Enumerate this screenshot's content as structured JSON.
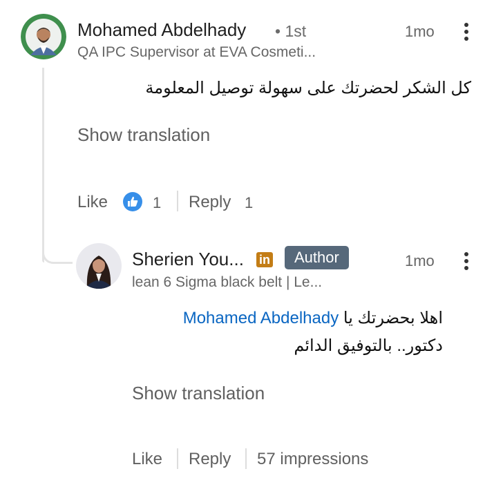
{
  "comment": {
    "author_name": "Mohamed Abdelhady",
    "degree": "• 1st",
    "headline": "QA IPC Supervisor at EVA Cosmeti...",
    "time": "1mo",
    "body": "كل الشكر لحضرتك على سهولة توصيل المعلومة",
    "show_translation": "Show translation",
    "like_label": "Like",
    "like_count": "1",
    "reply_label": "Reply",
    "reply_count": "1",
    "avatar_icon": "profile-photo",
    "more_icon": "kebab-menu"
  },
  "reply": {
    "author_name": "Sherien You...",
    "linkedin_badge": "in",
    "author_badge": "Author",
    "headline": "lean 6 Sigma black belt | Le...",
    "time": "1mo",
    "body_prefix": "اهلا بحضرتك يا",
    "mention": "Mohamed Abdelhady",
    "body_suffix": "دكتور.. بالتوفيق الدائم",
    "show_translation": "Show translation",
    "like_label": "Like",
    "reply_label": "Reply",
    "impressions": "57 impressions",
    "avatar_icon": "profile-photo",
    "more_icon": "kebab-menu"
  },
  "colors": {
    "link_blue": "#0a66c2",
    "author_badge_bg": "#56687a",
    "linkedin_badge_bg": "#c37d16",
    "like_icon_bg": "#378fe9"
  }
}
